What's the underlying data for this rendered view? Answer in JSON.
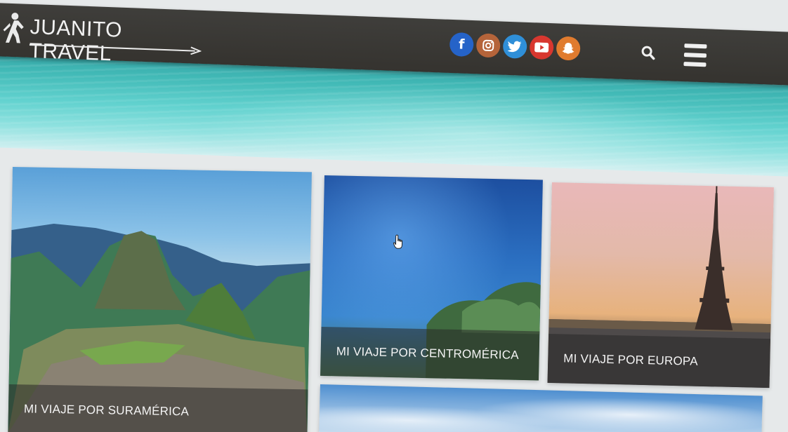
{
  "header": {
    "brand": "JUANITO TRAVEL",
    "social": [
      {
        "name": "facebook-icon",
        "glyph": "f",
        "color": "#2563c8"
      },
      {
        "name": "instagram-icon",
        "glyph": "",
        "color": "#b5643a"
      },
      {
        "name": "twitter-icon",
        "glyph": "",
        "color": "#2f8fd8"
      },
      {
        "name": "youtube-icon",
        "glyph": "",
        "color": "#d8372f"
      },
      {
        "name": "snapchat-icon",
        "glyph": "",
        "color": "#e07b2e"
      }
    ],
    "search_icon": "search-icon",
    "menu_icon": "hamburger-menu-icon"
  },
  "cards": [
    {
      "label": "MI VIAJE POR SURAMÉRICA",
      "image": "machu-picchu"
    },
    {
      "label": "MI VIAJE POR CENTROMÉRICA",
      "image": "blue-sky-trees"
    },
    {
      "label": "MI VIAJE POR EUROPA",
      "image": "eiffel-tower-sunset"
    },
    {
      "label": "",
      "image": "clouds-sky"
    }
  ],
  "colors": {
    "header_bg": "#3b3936",
    "page_bg": "#e6e9ea",
    "label_overlay": "rgba(40,40,40,.55)"
  }
}
